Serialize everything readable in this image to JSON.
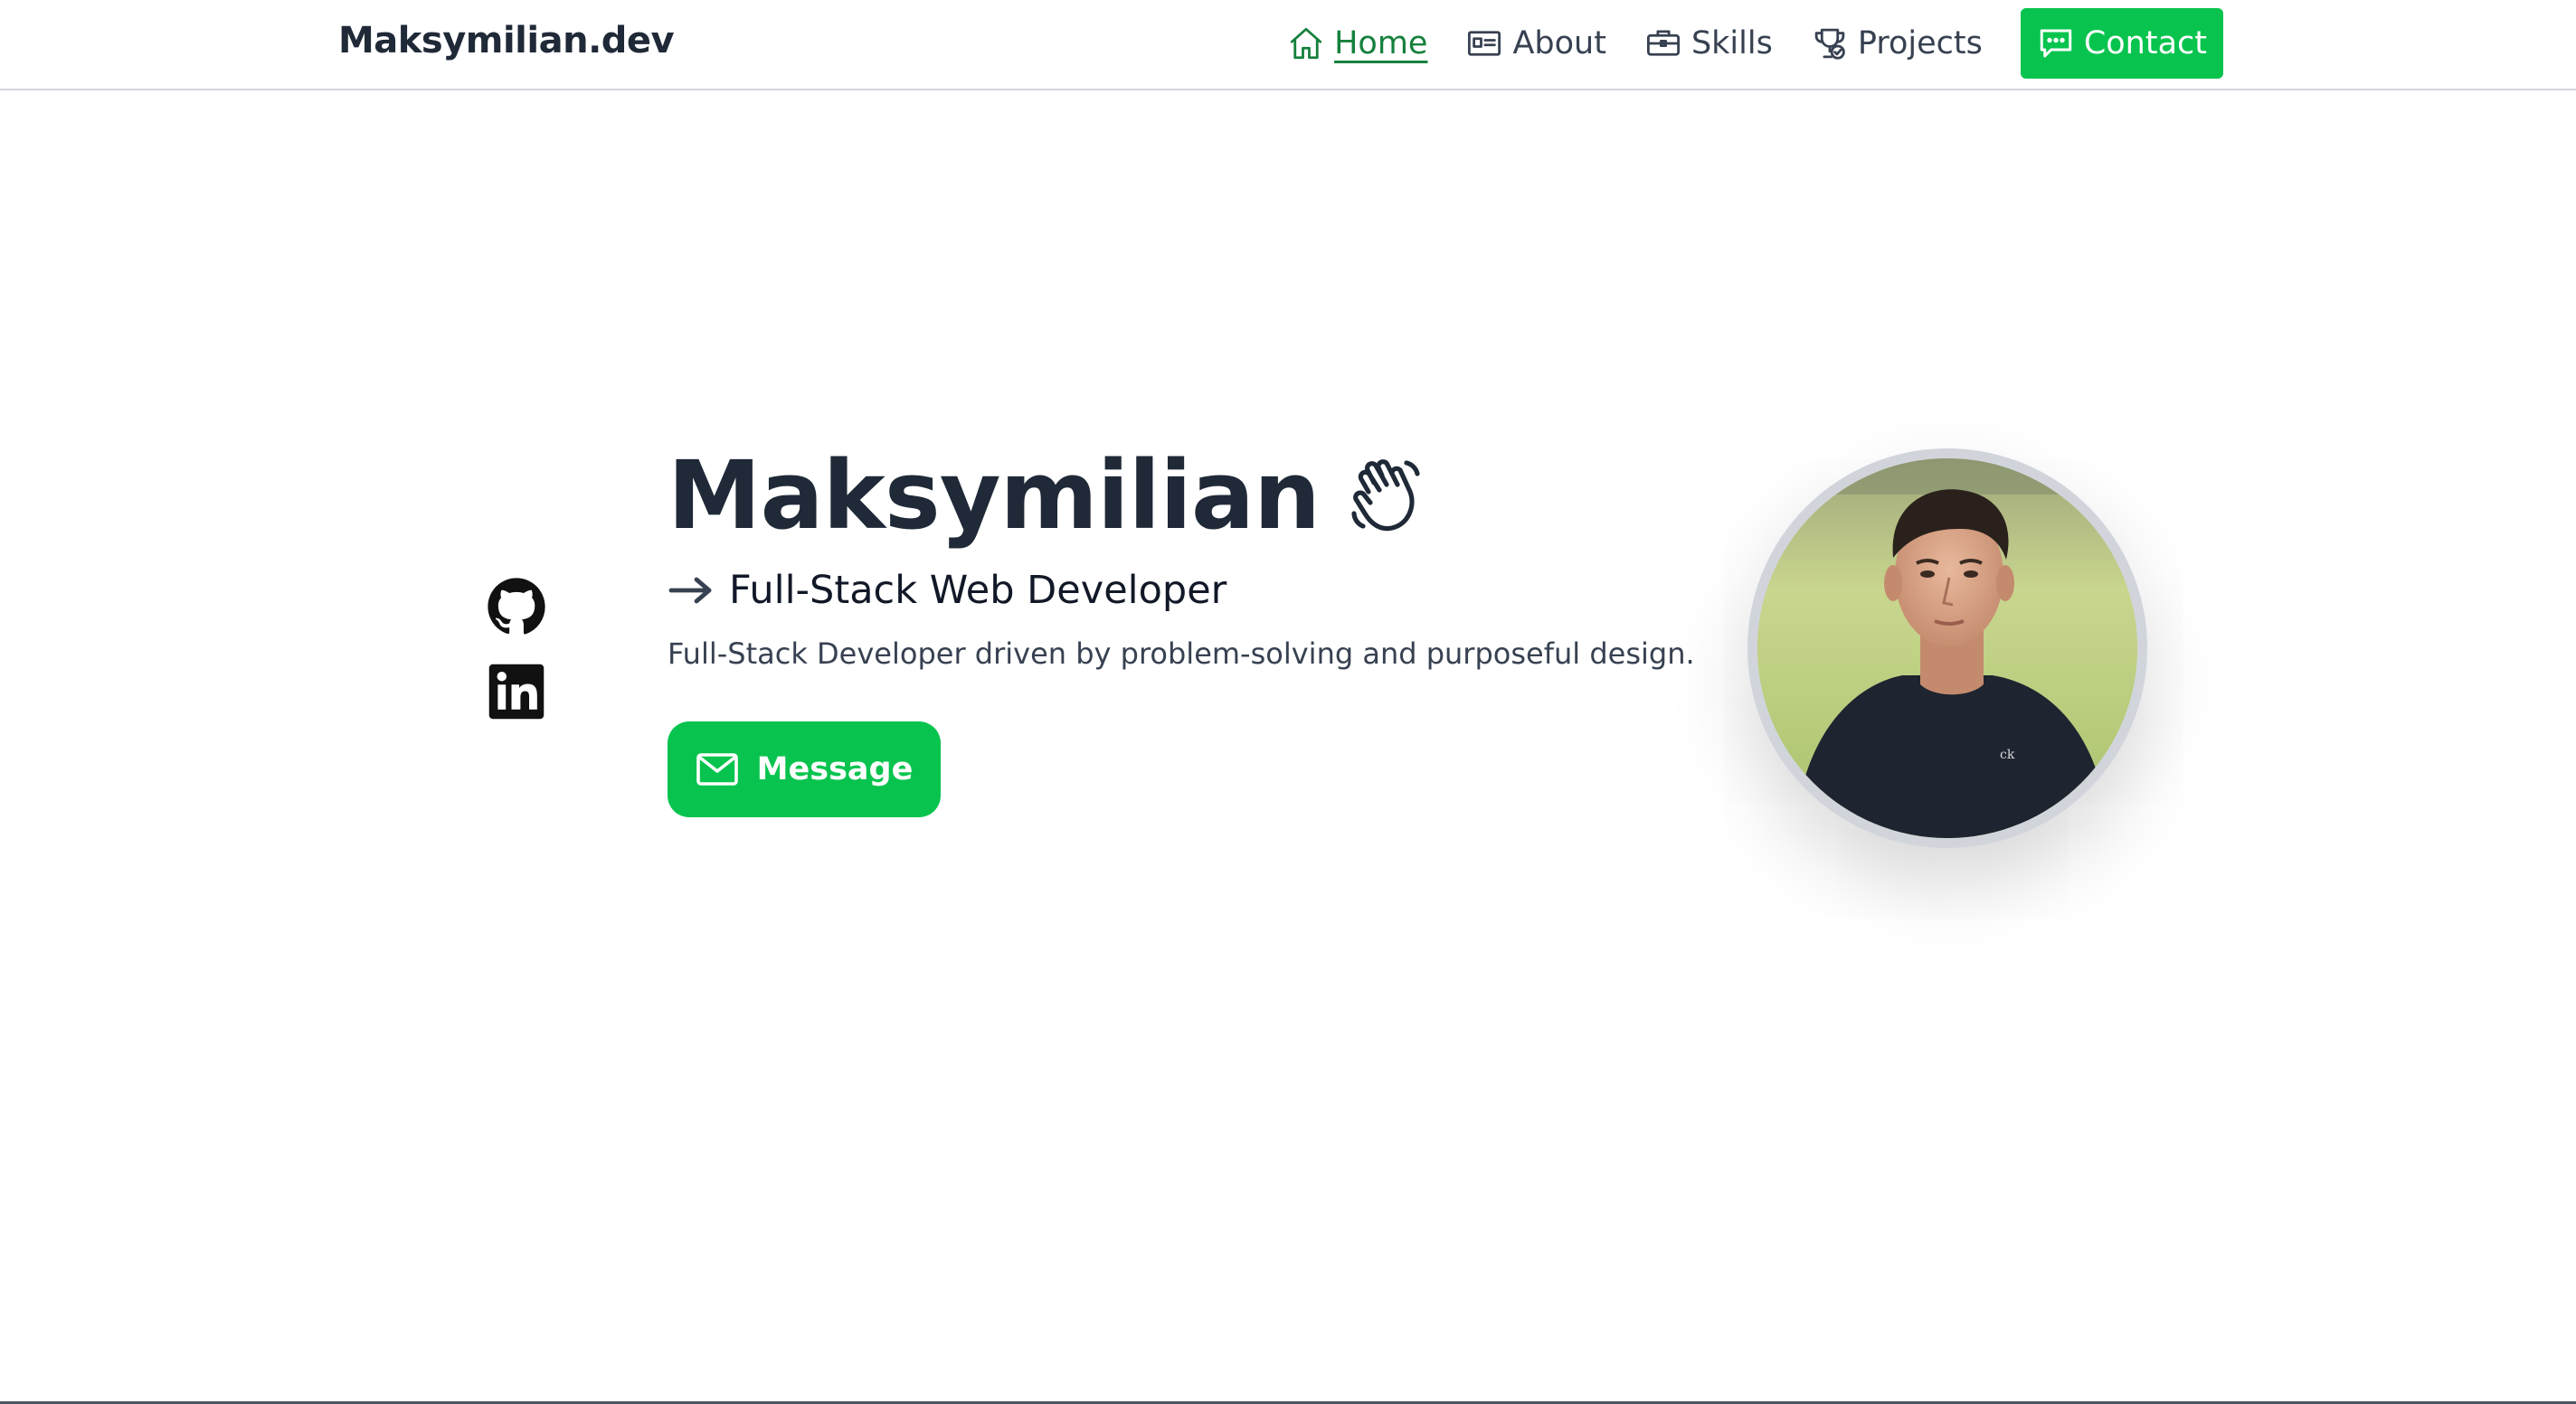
{
  "header": {
    "brand": "Maksymilian.dev",
    "nav": [
      {
        "label": "Home",
        "icon": "home-icon",
        "active": true
      },
      {
        "label": "About",
        "icon": "id-card-icon",
        "active": false
      },
      {
        "label": "Skills",
        "icon": "briefcase-icon",
        "active": false
      },
      {
        "label": "Projects",
        "icon": "trophy-check-icon",
        "active": false
      },
      {
        "label": "Contact",
        "icon": "chat-icon",
        "active": false
      }
    ]
  },
  "socials": [
    {
      "icon": "github-icon"
    },
    {
      "icon": "linkedin-icon"
    }
  ],
  "hero": {
    "name": "Maksymilian",
    "name_icon": "waving-hand-icon",
    "role_icon": "arrow-right-icon",
    "role": "Full-Stack Web Developer",
    "description": "Full-Stack Developer driven by problem-solving and purposeful design.",
    "button_icon": "mail-icon",
    "button_label": "Message"
  },
  "portrait": {
    "alt": "profile-photo"
  },
  "colors": {
    "accent": "#08c44e",
    "active_nav": "#15803d",
    "text": "#1f2937",
    "muted": "#374151",
    "border": "#d1d5db"
  }
}
